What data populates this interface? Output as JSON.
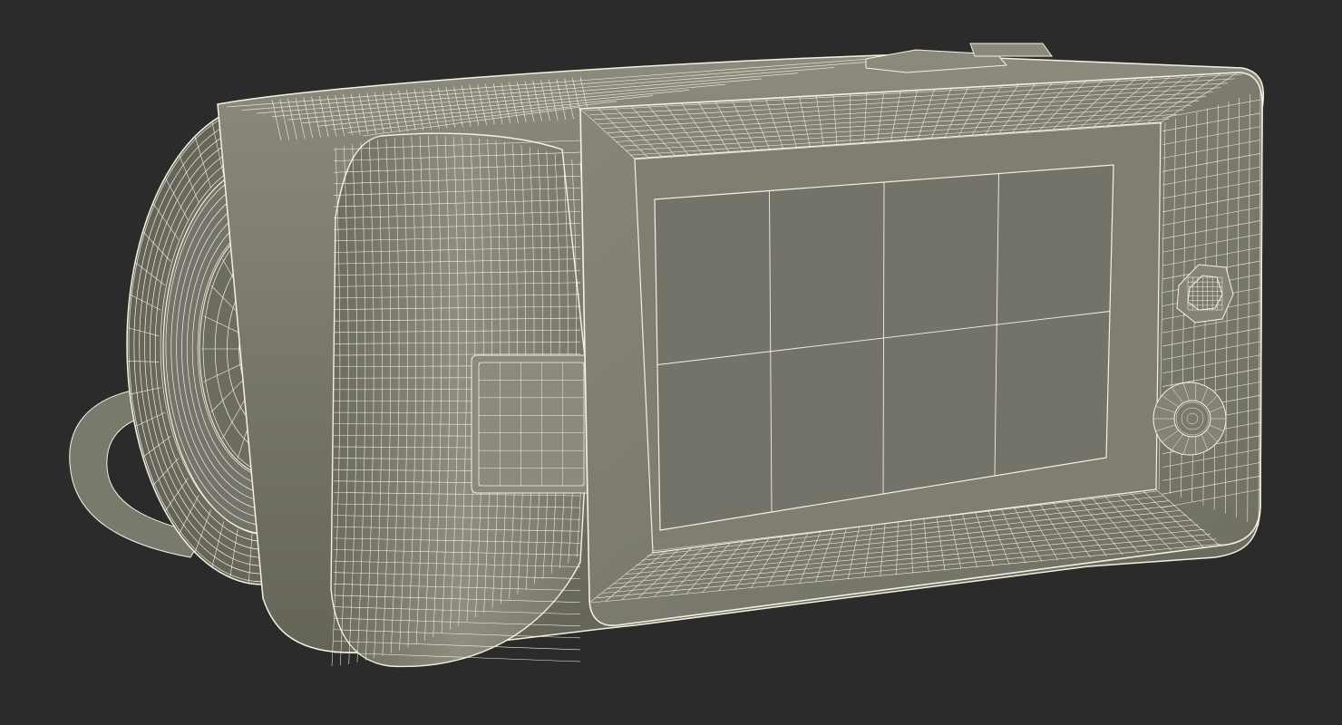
{
  "scene": {
    "subject": "camcorder",
    "render_style": "wireframe",
    "colors": {
      "background": "#2b2b2b",
      "body_fill": "#7e7d70",
      "body_shade": "#67665b",
      "body_light": "#a09f90",
      "wire": "#f4f2e1",
      "screen_fill": "#76756a"
    }
  }
}
